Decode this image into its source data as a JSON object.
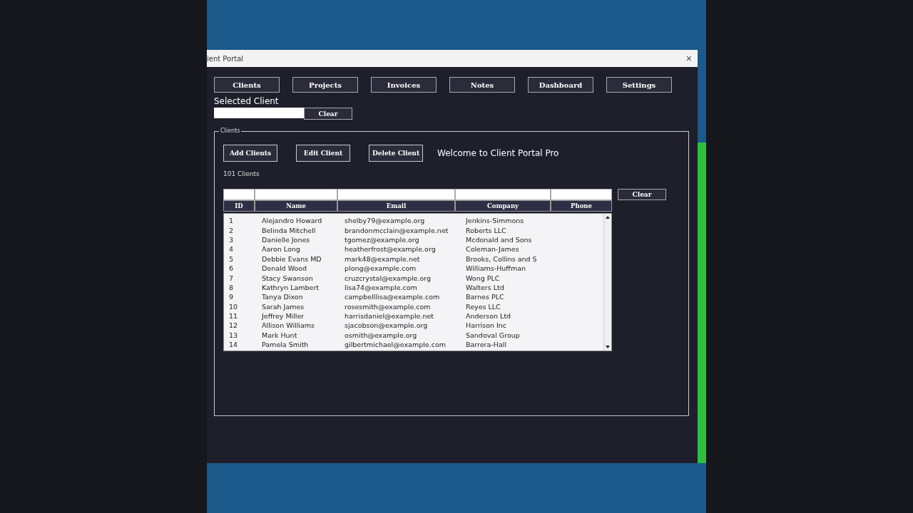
{
  "window": {
    "title": "ient Portal",
    "close": "×"
  },
  "tabs": [
    {
      "label": "Clients"
    },
    {
      "label": "Projects"
    },
    {
      "label": "Invoices"
    },
    {
      "label": "Notes"
    },
    {
      "label": "Dashboard"
    },
    {
      "label": "Settings"
    }
  ],
  "selected_client": {
    "label": "Selected Client",
    "clear_button": "Clear"
  },
  "clients_group": {
    "title": "Clients",
    "buttons": [
      "Add Clients",
      "Edit Client",
      "Delete Client"
    ],
    "welcome": "Welcome to Client Portal Pro",
    "count": "101 Clients"
  },
  "table": {
    "columns": [
      "ID",
      "Name",
      "Email",
      "Company",
      "Phone"
    ],
    "clear_button": "Clear",
    "rows": [
      [
        "1",
        "Alejandro Howard",
        "shelby79@example.org",
        "Jenkins-Simmons"
      ],
      [
        "2",
        "Belinda Mitchell",
        "brandonmcclain@example.net",
        "Roberts LLC"
      ],
      [
        "3",
        "Danielle Jones",
        "tgomez@example.org",
        "Mcdonald and Sons"
      ],
      [
        "4",
        "Aaron Long",
        "heatherfrost@example.org",
        "Coleman-James"
      ],
      [
        "5",
        "Debbie Evans MD",
        "mark48@example.net",
        "Brooks, Collins and S"
      ],
      [
        "6",
        "Donald Wood",
        "plong@example.com",
        "Williams-Huffman"
      ],
      [
        "7",
        "Stacy Swanson",
        "cruzcrystal@example.org",
        "Wong PLC"
      ],
      [
        "8",
        "Kathryn Lambert",
        "lisa74@example.com",
        "Walters Ltd"
      ],
      [
        "9",
        "Tanya Dixon",
        "campbelllisa@example.com",
        "Barnes PLC"
      ],
      [
        "10",
        "Sarah James",
        "rosesmith@example.com",
        "Reyes LLC"
      ],
      [
        "11",
        "Jeffrey Miller",
        "harrisdaniel@example.net",
        "Anderson Ltd"
      ],
      [
        "12",
        "Allison Williams",
        "sjacobson@example.org",
        "Harrison Inc"
      ],
      [
        "13",
        "Mark Hunt",
        "osmith@example.org",
        "Sandoval Group"
      ],
      [
        "14",
        "Pamela Smith",
        "gilbertmichael@example.com",
        "Barrera-Hall"
      ]
    ]
  }
}
